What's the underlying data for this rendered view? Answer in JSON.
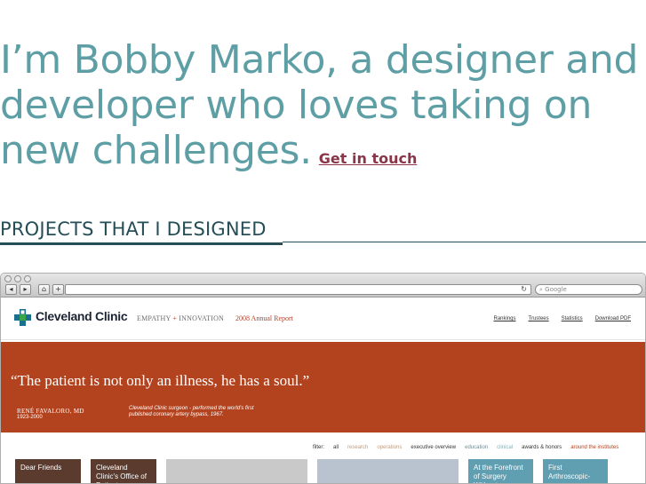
{
  "intro": {
    "text": "I’m Bobby Marko, a designer and developer who loves taking on new challenges.",
    "cta": "Get in touch"
  },
  "section": {
    "title": "PROJECTS THAT I DESIGNED"
  },
  "browser": {
    "search_placeholder": "Google",
    "nav": {
      "back": "◂",
      "forward": "▸",
      "home": "⌂",
      "add": "+"
    },
    "reload": "↻"
  },
  "site": {
    "logo": "Cleveland Clinic",
    "tagline_left": "EMPATHY",
    "tagline_sep": "+",
    "tagline_right": "INNOVATION",
    "report": "2008 Annual Report",
    "links": [
      "Rankings",
      "Trustees",
      "Statistics",
      "Download PDF"
    ],
    "quote": "“The patient is not only an illness, he has a soul.”",
    "author": "RENÉ FAVALORO, MD",
    "years": "1923-2000",
    "description": "Cleveland Clinic surgeon - performed the world's first published coronary artery bypass, 1967.",
    "filters": [
      {
        "label": "filter:",
        "color": "#333333"
      },
      {
        "label": "all",
        "color": "#333333"
      },
      {
        "label": "research",
        "color": "#c49a7a"
      },
      {
        "label": "operations",
        "color": "#c49a7a"
      },
      {
        "label": "executive overview",
        "color": "#333333"
      },
      {
        "label": "education",
        "color": "#6d8a9a"
      },
      {
        "label": "clinical",
        "color": "#7fb3b8"
      },
      {
        "label": "awards & honors",
        "color": "#333333"
      },
      {
        "label": "around the institutes",
        "color": "#b3431f"
      }
    ],
    "tiles": [
      {
        "label": "Dear Friends",
        "color": "#5a3b2e"
      },
      {
        "label": "Cleveland Clinic's Office of Patient",
        "color": "#5a3b2e"
      },
      {
        "label": "",
        "color": "#c9c9c9"
      },
      {
        "label": "",
        "color": "#b8c3cf"
      },
      {
        "label": "At the Forefront of Surgery Without",
        "color": "#5f9fb1"
      },
      {
        "label": "First Arthroscopic-",
        "color": "#5f9fb1"
      }
    ]
  },
  "colors": {
    "accent": "#5e9ea5",
    "cta": "#8a3548",
    "hero": "#b3431f",
    "heading": "#254e57"
  }
}
